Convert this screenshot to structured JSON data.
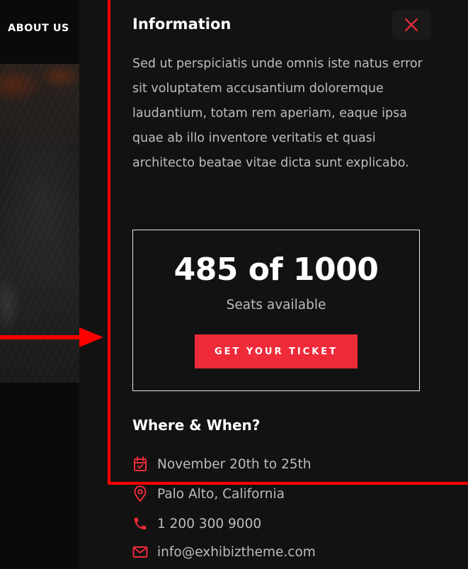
{
  "background": {
    "nav_about": "ABOUT US"
  },
  "panel": {
    "title": "Information",
    "description": "Sed ut perspiciatis unde omnis iste natus error sit voluptatem accusantium doloremque laudantium, totam rem aperiam, eaque ipsa quae ab illo inventore veritatis et quasi architecto beatae vitae dicta sunt explicabo.",
    "seats": {
      "count": "485 of 1000",
      "label": "Seats available",
      "button_label": "GET YOUR TICKET"
    },
    "where_when": {
      "title": "Where & When?",
      "date": "November 20th to 25th",
      "location": "Palo Alto, California",
      "phone": "1 200 300 9000",
      "email": "info@exhibiztheme.com"
    }
  },
  "colors": {
    "accent": "#ef2b3a",
    "panel_bg": "#121212",
    "text_muted": "#bdbdbd",
    "annotation": "#ff0000"
  },
  "icons": {
    "close": "close-icon",
    "date": "calendar-check-icon",
    "location": "map-pin-icon",
    "phone": "phone-icon",
    "email": "envelope-icon"
  }
}
